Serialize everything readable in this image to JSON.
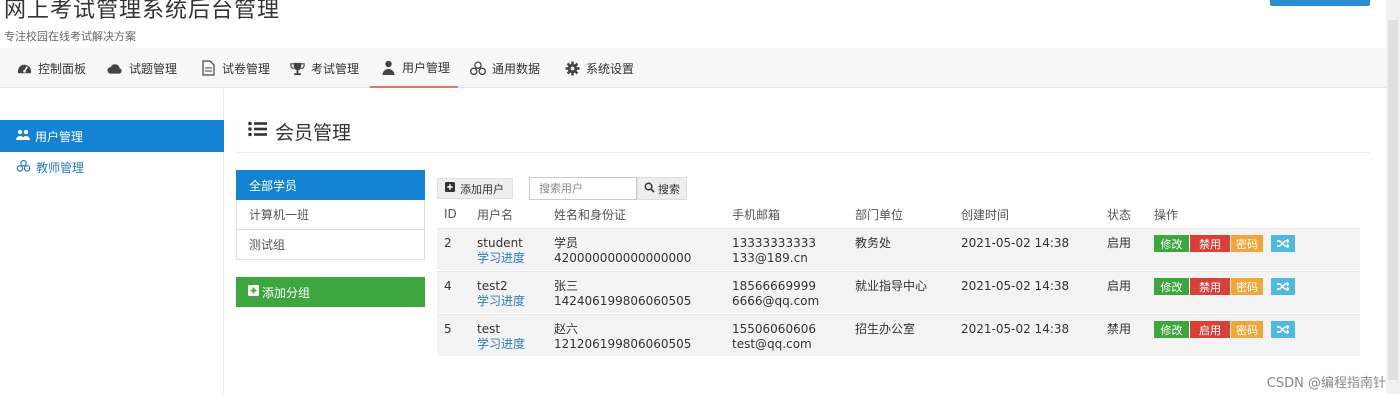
{
  "header": {
    "title": "网上考试管理系统后台管理",
    "subtitle": "专注校园在线考试解决方案"
  },
  "nav": {
    "items": [
      {
        "label": "控制面板",
        "icon": "dashboard-icon"
      },
      {
        "label": "试题管理",
        "icon": "cloud-icon"
      },
      {
        "label": "试卷管理",
        "icon": "document-icon"
      },
      {
        "label": "考试管理",
        "icon": "trophy-icon"
      },
      {
        "label": "用户管理",
        "icon": "user-icon",
        "active": true
      },
      {
        "label": "通用数据",
        "icon": "cubes-icon"
      },
      {
        "label": "系统设置",
        "icon": "gear-icon"
      }
    ]
  },
  "sidebar": {
    "items": [
      {
        "label": "用户管理",
        "icon": "users-icon",
        "active": true
      },
      {
        "label": "教师管理",
        "icon": "cubes-icon"
      }
    ]
  },
  "main": {
    "title": "会员管理",
    "groups": [
      {
        "label": "全部学员",
        "active": true
      },
      {
        "label": "计算机一班"
      },
      {
        "label": "测试组"
      }
    ],
    "add_group_label": "添加分组",
    "add_user_label": "添加用户",
    "search": {
      "placeholder": "搜索用户",
      "button_label": "搜索"
    }
  },
  "table": {
    "headers": [
      "ID",
      "用户名",
      "姓名和身份证",
      "手机邮箱",
      "部门单位",
      "创建时间",
      "状态",
      "操作"
    ],
    "rows": [
      {
        "id": "2",
        "username": "student",
        "progress": "学习进度",
        "name": "学员",
        "idcard": "420000000000000000",
        "phone": "13333333333",
        "email": "133@189.cn",
        "dept": "教务处",
        "created": "2021-05-02 14:38",
        "status": "启用",
        "edit": "修改",
        "toggle": "禁用",
        "pwd": "密码"
      },
      {
        "id": "4",
        "username": "test2",
        "progress": "学习进度",
        "name": "张三",
        "idcard": "142406199806060505",
        "phone": "18566669999",
        "email": "6666@qq.com",
        "dept": "就业指导中心",
        "created": "2021-05-02 14:38",
        "status": "启用",
        "edit": "修改",
        "toggle": "禁用",
        "pwd": "密码"
      },
      {
        "id": "5",
        "username": "test",
        "progress": "学习进度",
        "name": "赵六",
        "idcard": "121206199806060505",
        "phone": "15506060606",
        "email": "test@qq.com",
        "dept": "招生办公室",
        "created": "2021-05-02 14:38",
        "status": "禁用",
        "edit": "修改",
        "toggle": "启用",
        "pwd": "密码"
      }
    ]
  },
  "watermark": "CSDN @编程指南针",
  "colors": {
    "primary": "#1583d3",
    "success": "#3da63f",
    "danger": "#d9403a",
    "warning": "#efa63a",
    "info": "#4fb9e0",
    "nav_active": "#e87461"
  }
}
